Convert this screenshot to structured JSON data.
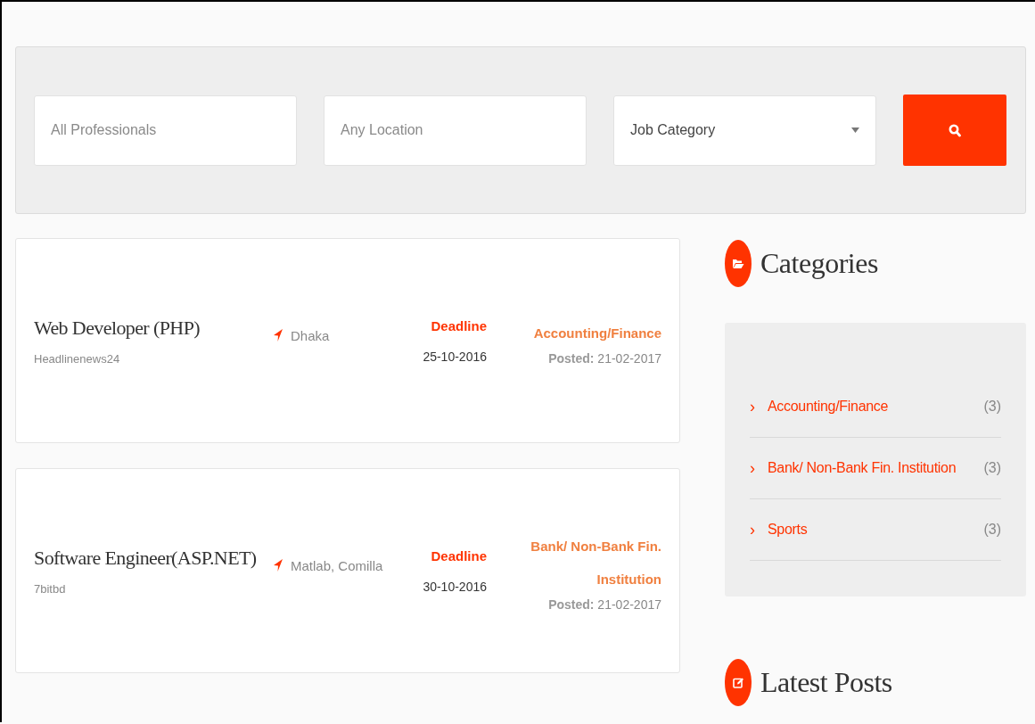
{
  "search": {
    "keyword": {
      "placeholder": "All Professionals"
    },
    "location": {
      "placeholder": "Any Location"
    },
    "category": {
      "value": "Job Category"
    }
  },
  "jobs": [
    {
      "title": "Web Developer (PHP)",
      "company": "Headlinenews24",
      "location": "Dhaka",
      "deadline_label": "Deadline",
      "deadline": "25-10-2016",
      "category": "Accounting/Finance",
      "posted_label": "Posted:",
      "posted": "21-02-2017"
    },
    {
      "title": "Software Engineer(ASP.NET)",
      "company": "7bitbd",
      "location": "Matlab, Comilla",
      "deadline_label": "Deadline",
      "deadline": "30-10-2016",
      "category": "Bank/ Non-Bank Fin. Institution",
      "posted_label": "Posted:",
      "posted": "21-02-2017"
    }
  ],
  "sidebar": {
    "categories": {
      "title": "Categories",
      "items": [
        {
          "marker": "›",
          "name": "Accounting/Finance",
          "count": "(3)"
        },
        {
          "marker": "›",
          "name": "Bank/ Non-Bank Fin. Institution",
          "count": "(3)"
        },
        {
          "marker": "›",
          "name": "Sports",
          "count": "(3)"
        }
      ]
    },
    "latest_posts": {
      "title": "Latest Posts"
    }
  }
}
